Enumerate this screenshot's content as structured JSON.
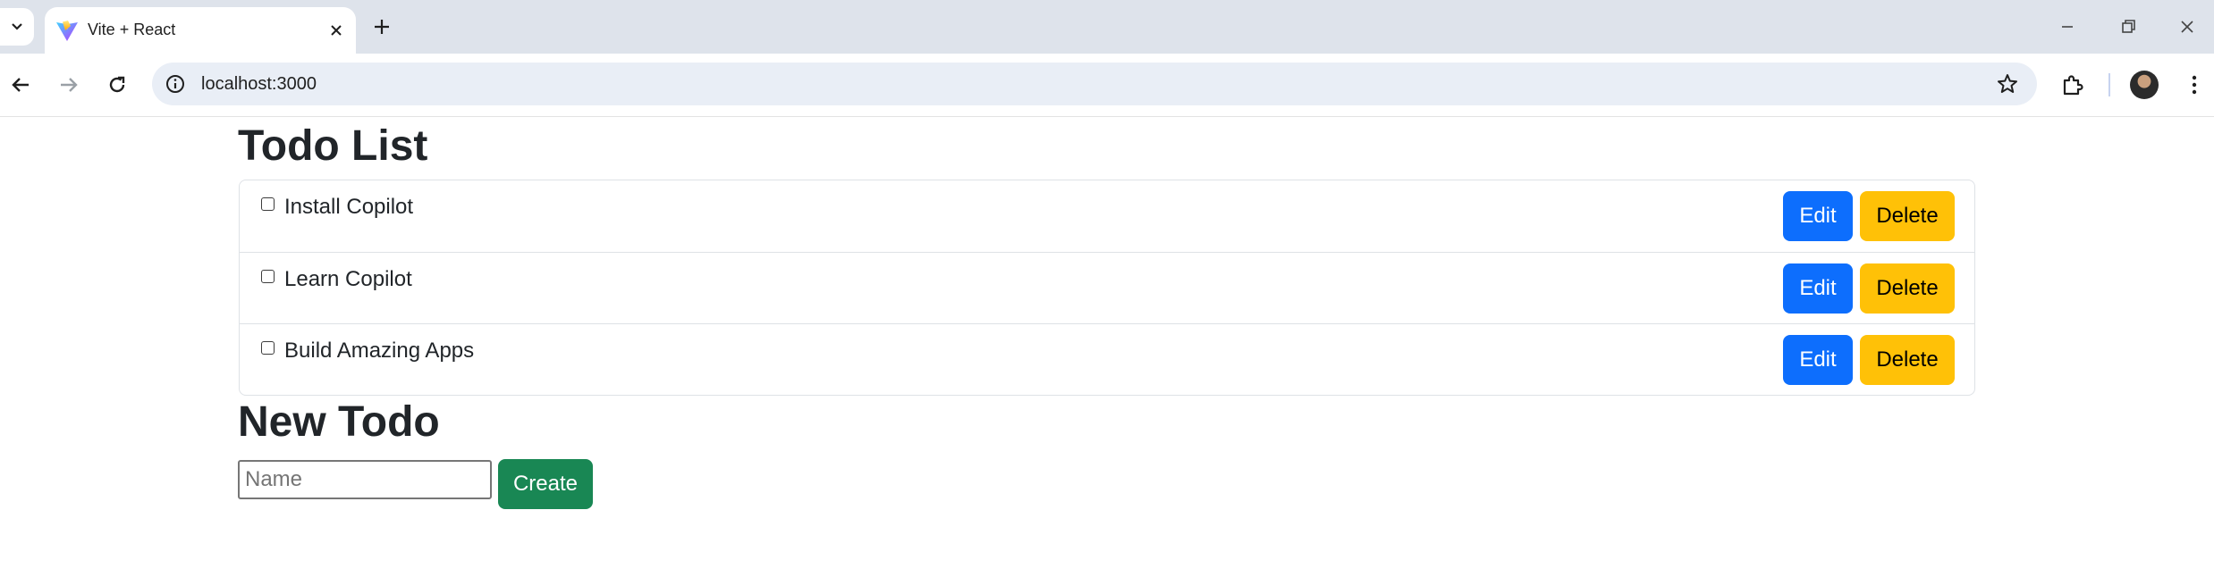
{
  "browser": {
    "tab_title": "Vite + React",
    "url": "localhost:3000"
  },
  "page": {
    "title": "Todo List",
    "todos": [
      {
        "label": "Install Copilot",
        "checked": false
      },
      {
        "label": "Learn Copilot",
        "checked": false
      },
      {
        "label": "Build Amazing Apps",
        "checked": false
      }
    ],
    "edit_label": "Edit",
    "delete_label": "Delete",
    "new_section_title": "New Todo",
    "name_placeholder": "Name",
    "name_value": "",
    "create_label": "Create"
  },
  "colors": {
    "edit": "#0d6efd",
    "delete": "#ffc107",
    "create": "#198754"
  }
}
